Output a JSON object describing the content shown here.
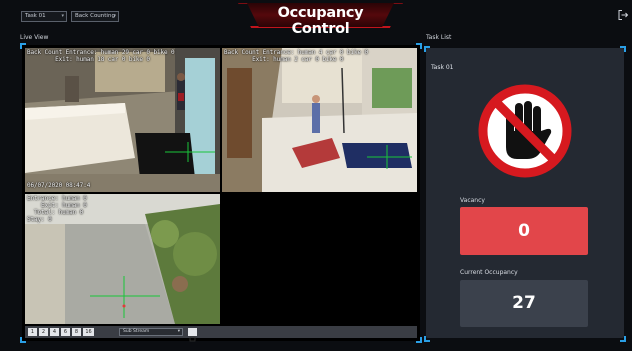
{
  "header": {
    "task_select": "Task 01",
    "mode_select": "Back Counting",
    "title": "Occupancy Control"
  },
  "labels": {
    "live_view": "Live View",
    "task_list": "Task List"
  },
  "cameras": [
    {
      "osd_top": "Back Count Entrance: human 29 car 0 bike 0\n        Exit: human 18 car 0 bike 0",
      "osd_bottom": "06/07/2020 08:47:4"
    },
    {
      "osd_top": "Back Count Entrance: human 4 car 0 bike 0\n        Exit: human 2 car 0 bike 0"
    },
    {
      "osd_top": "Entrance: human 0\n    Exit: human 0\n  Total: human 0\nStay: 0"
    }
  ],
  "toolbar": {
    "layouts": [
      "1",
      "2",
      "4",
      "6",
      "8",
      "16"
    ],
    "stream": "Sub Stream"
  },
  "task_panel": {
    "task_name": "Task 01",
    "vacancy_label": "Vacancy",
    "vacancy_value": "0",
    "occupancy_label": "Current Occupancy",
    "occupancy_value": "27",
    "colors": {
      "vacancy": "#e2464a",
      "occupancy": "#3b414c",
      "stop": "#d6191f"
    }
  },
  "icons": {
    "exit": "logout-icon",
    "stop": "stop-hand-icon"
  }
}
